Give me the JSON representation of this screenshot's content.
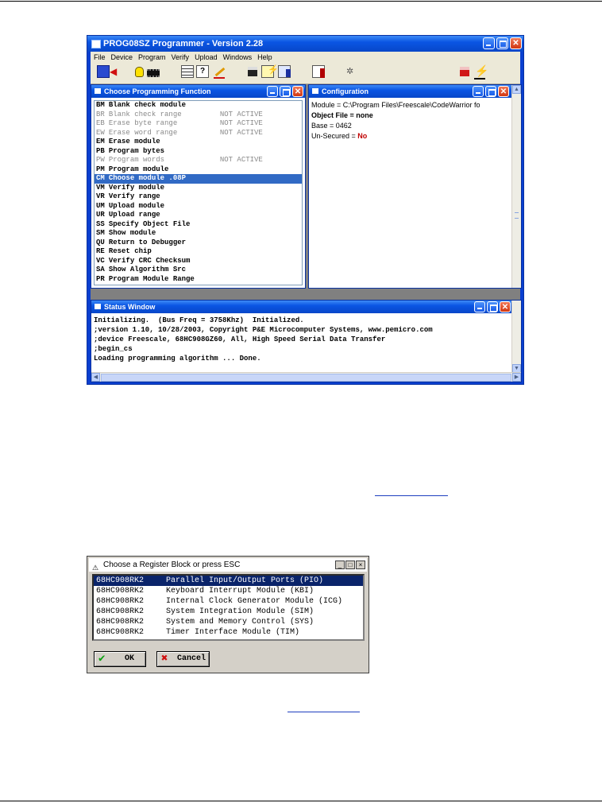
{
  "app": {
    "title": "PROG08SZ Programmer - Version 2.28",
    "menu": [
      "File",
      "Device",
      "Program",
      "Verify",
      "Upload",
      "Windows",
      "Help"
    ]
  },
  "choose_function": {
    "title": "Choose Programming Function",
    "items": [
      {
        "code": "BM",
        "label": "Blank check module",
        "status": "",
        "state": "active"
      },
      {
        "code": "BR",
        "label": "Blank check range",
        "status": "NOT ACTIVE",
        "state": "inactive"
      },
      {
        "code": "EB",
        "label": "Erase byte range",
        "status": "NOT ACTIVE",
        "state": "inactive"
      },
      {
        "code": "EW",
        "label": "Erase word range",
        "status": "NOT ACTIVE",
        "state": "inactive"
      },
      {
        "code": "EM",
        "label": "Erase module",
        "status": "",
        "state": "active"
      },
      {
        "code": "PB",
        "label": "Program bytes",
        "status": "",
        "state": "active"
      },
      {
        "code": "PW",
        "label": "Program words",
        "status": "NOT ACTIVE",
        "state": "inactive"
      },
      {
        "code": "PM",
        "label": "Program module",
        "status": "",
        "state": "active"
      },
      {
        "code": "CM",
        "label": "Choose module .08P",
        "status": "",
        "state": "selected"
      },
      {
        "code": "VM",
        "label": "Verify module",
        "status": "",
        "state": "active"
      },
      {
        "code": "VR",
        "label": "Verify range",
        "status": "",
        "state": "active"
      },
      {
        "code": "UM",
        "label": "Upload module",
        "status": "",
        "state": "active"
      },
      {
        "code": "UR",
        "label": "Upload range",
        "status": "",
        "state": "active"
      },
      {
        "code": "SS",
        "label": "Specify Object File",
        "status": "",
        "state": "active"
      },
      {
        "code": "SM",
        "label": "Show module",
        "status": "",
        "state": "active"
      },
      {
        "code": "QU",
        "label": "Return to Debugger",
        "status": "",
        "state": "active"
      },
      {
        "code": "RE",
        "label": "Reset chip",
        "status": "",
        "state": "active"
      },
      {
        "code": "VC",
        "label": "Verify CRC Checksum",
        "status": "",
        "state": "active"
      },
      {
        "code": "SA",
        "label": "Show Algorithm Src",
        "status": "",
        "state": "active"
      },
      {
        "code": "PR",
        "label": "Program Module Range",
        "status": "",
        "state": "active"
      }
    ]
  },
  "configuration": {
    "title": "Configuration",
    "module": "Module = C:\\Program Files\\Freescale\\CodeWarrior fo",
    "object_file": "Object File = none",
    "base": "Base = 0462",
    "unsecured_label": "Un-Secured = ",
    "unsecured_value": "No",
    "unsecured_color": "#c00000"
  },
  "status_window": {
    "title": "Status Window",
    "lines": [
      "Initializing.  (Bus Freq = 3758Khz)  Initialized.",
      ";version 1.10, 10/28/2003, Copyright P&E Microcomputer Systems, www.pemicro.com",
      ";device Freescale, 68HC908GZ60, All, High Speed Serial Data Transfer",
      ";begin_cs",
      "Loading programming algorithm ... Done."
    ]
  },
  "register_dialog": {
    "title": "Choose a Register Block or press ESC",
    "items": [
      {
        "chip": "68HC908RK2",
        "name": "Parallel Input/Output Ports (PIO)",
        "selected": true
      },
      {
        "chip": "68HC908RK2",
        "name": "Keyboard Interrupt Module (KBI)",
        "selected": false
      },
      {
        "chip": "68HC908RK2",
        "name": "Internal Clock Generator Module (ICG)",
        "selected": false
      },
      {
        "chip": "68HC908RK2",
        "name": "System Integration Module (SIM)",
        "selected": false
      },
      {
        "chip": "68HC908RK2",
        "name": "System and Memory Control (SYS)",
        "selected": false
      },
      {
        "chip": "68HC908RK2",
        "name": "Timer Interface Module (TIM)",
        "selected": false
      }
    ],
    "ok_label": "OK",
    "cancel_label": "Cancel"
  },
  "icons": [
    "app-icon",
    "minimize-icon",
    "maximize-icon",
    "close-icon",
    "check-icon",
    "x-icon"
  ]
}
